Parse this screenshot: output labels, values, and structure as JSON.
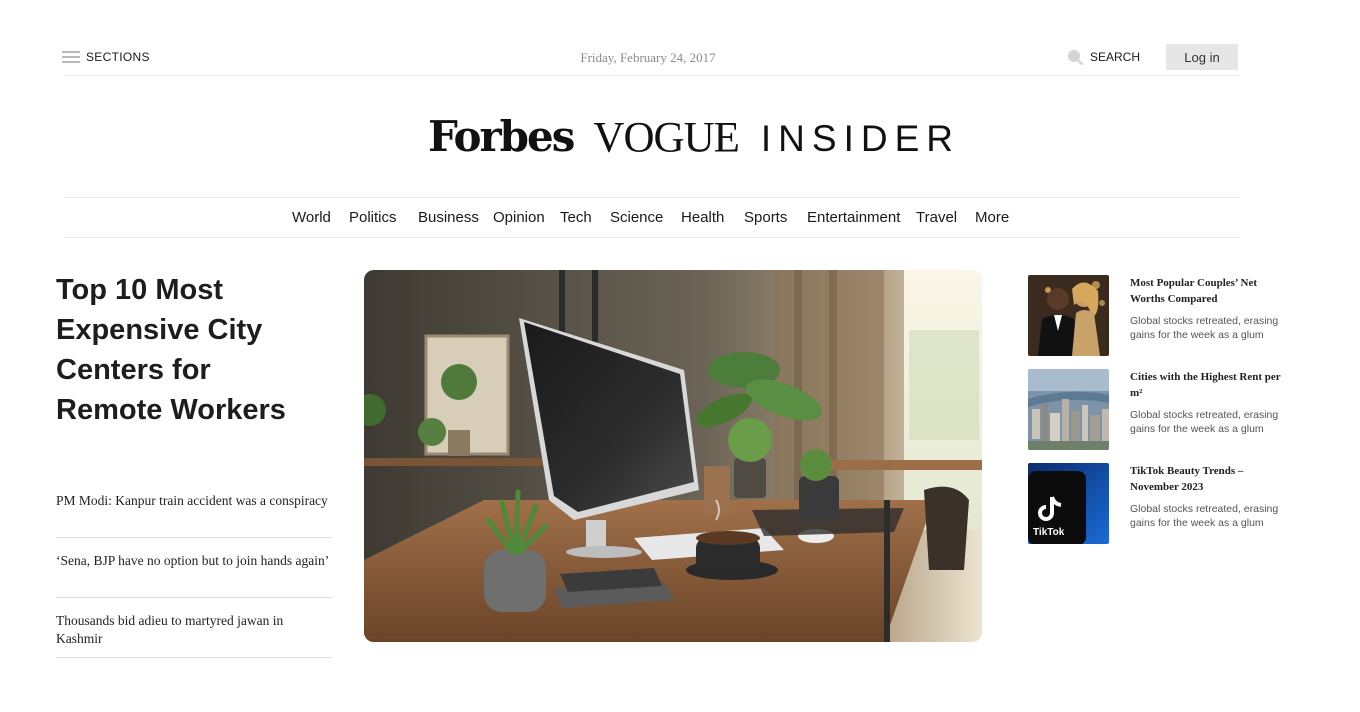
{
  "header": {
    "sections_label": "SECTIONS",
    "date": "Friday, February 24, 2017",
    "search_label": "SEARCH",
    "login_label": "Log in"
  },
  "logos": {
    "forbes": "Forbes",
    "vogue": "VOGUE",
    "insider": "INSIDER"
  },
  "nav": {
    "items": [
      "World",
      "Politics",
      "Business",
      "Opinion",
      "Tech",
      "Science",
      "Health",
      "Sports",
      "Entertainment",
      "Travel",
      "More"
    ]
  },
  "main": {
    "headline": "Top 10 Most Expensive City Centers for Remote Workers",
    "news": [
      "PM Modi: Kanpur train accident was a conspiracy",
      "‘Sena, BJP have no option but to join hands again’",
      "Thousands bid adieu to martyred jawan in Kashmir"
    ]
  },
  "sidebar": {
    "items": [
      {
        "title": "Most Popular Couples’ Net Worths Compared",
        "desc": "Global stocks retreated, erasing gains for the week as a glum",
        "thumb": "couple-photo"
      },
      {
        "title": "Cities with the Highest Rent per m²",
        "desc": "Global stocks retreated, erasing gains for the week as a glum",
        "thumb": "city-aerial-photo"
      },
      {
        "title": "TikTok Beauty Trends – November 2023",
        "desc": "Global stocks retreated, erasing gains for the week as a glum",
        "thumb": "tiktok-logo-photo",
        "thumb_text": "TikTok"
      }
    ]
  },
  "colors": {
    "login_bg": "#e6e6e6",
    "divider": "#e6e6e6",
    "muted_text": "#8a8a8a"
  }
}
